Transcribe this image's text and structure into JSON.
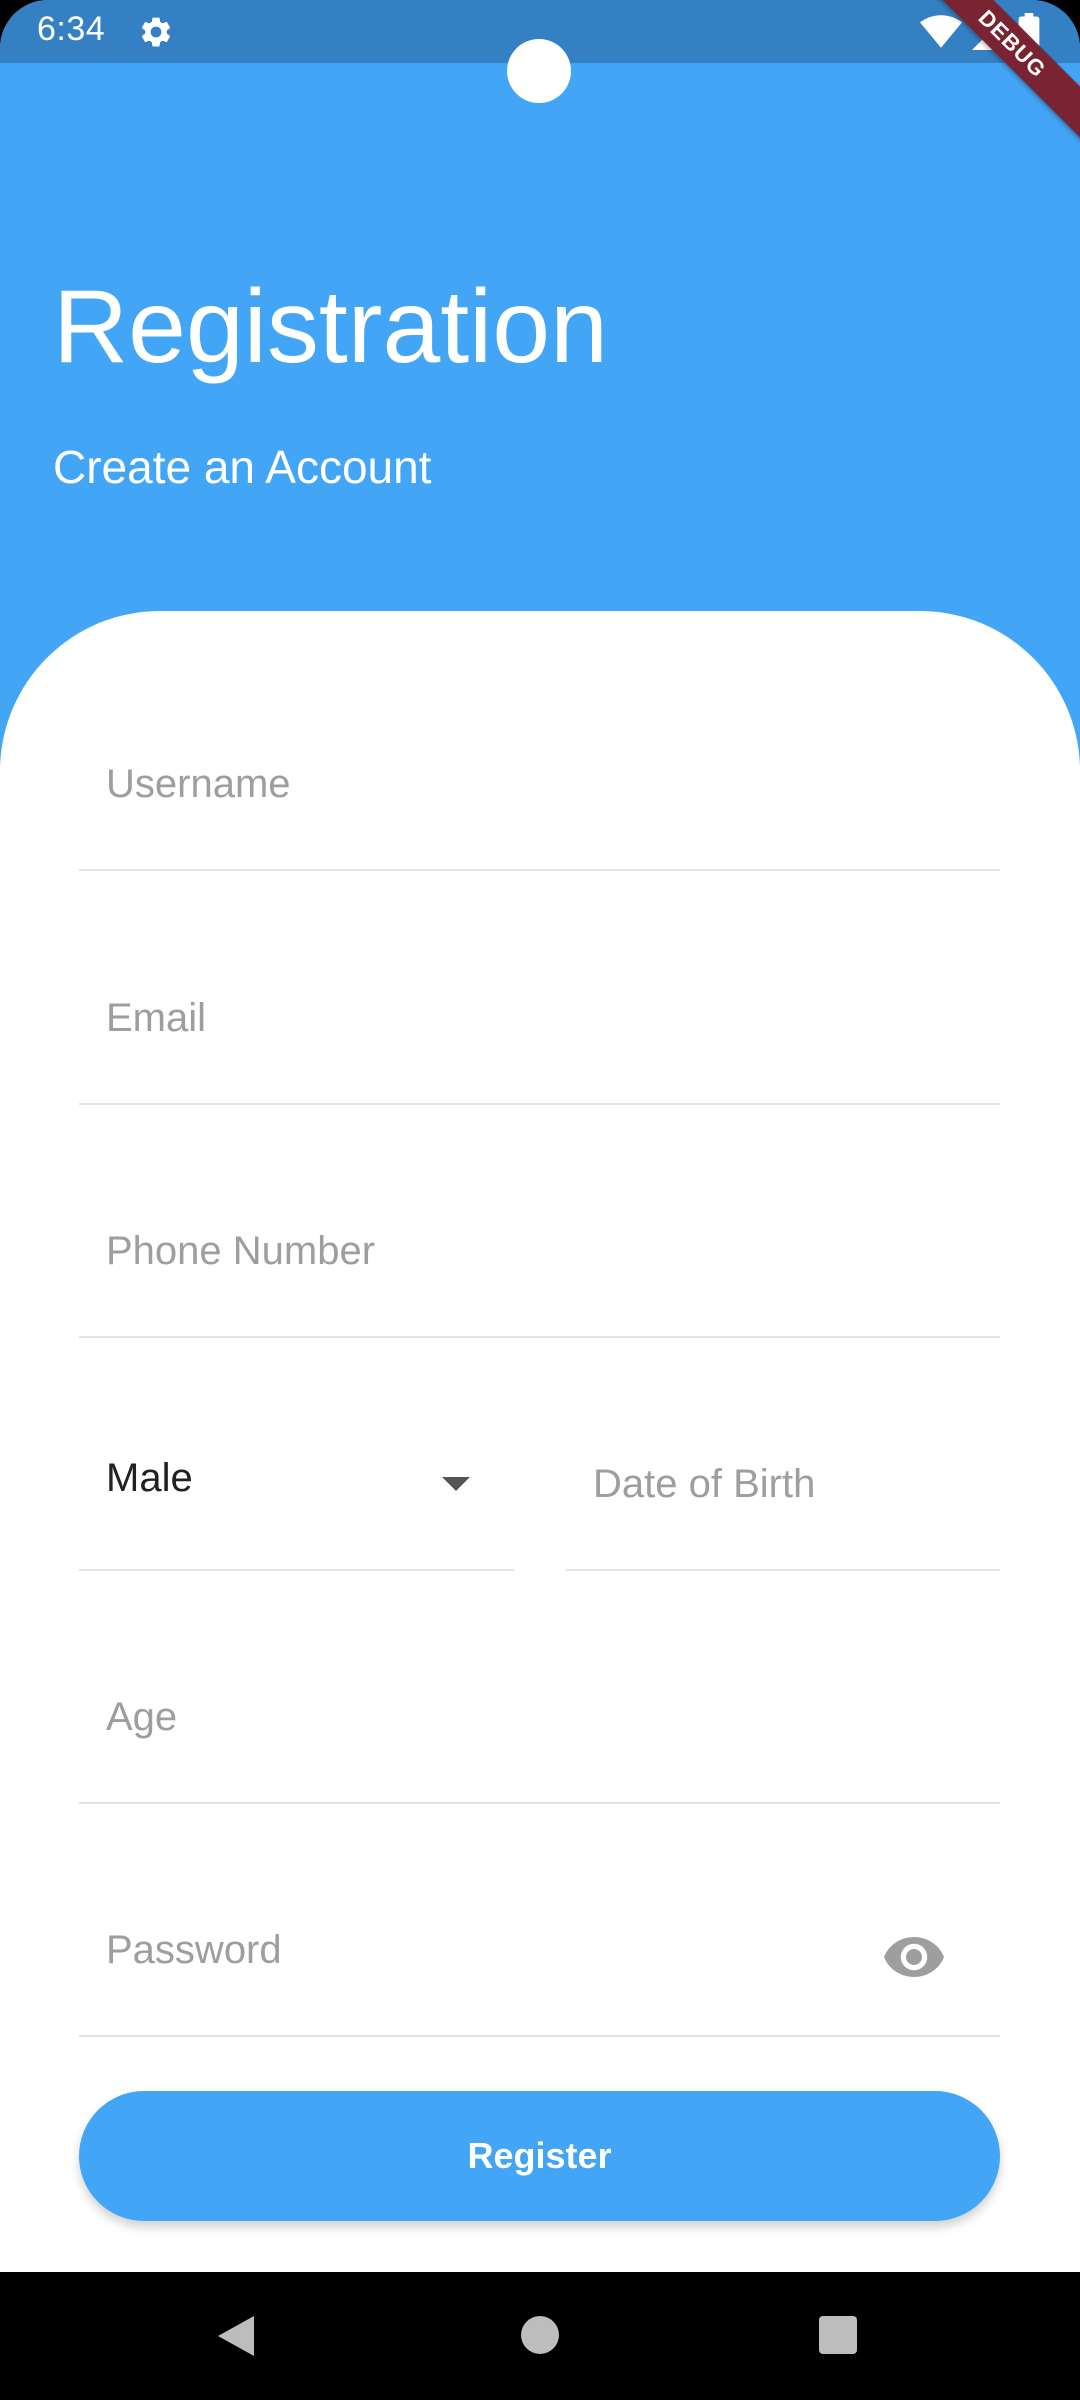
{
  "status_bar": {
    "time": "6:34",
    "icons": [
      "gear-icon",
      "wifi-icon",
      "signal-icon",
      "battery-icon"
    ]
  },
  "debug_banner": "DEBUG",
  "header": {
    "title": "Registration",
    "subtitle": "Create an Account"
  },
  "form": {
    "username_label": "Username",
    "email_label": "Email",
    "phone_label": "Phone Number",
    "gender_value": "Male",
    "dob_label": "Date of Birth",
    "age_label": "Age",
    "password_label": "Password",
    "register_label": "Register"
  },
  "nav_bar": {
    "icons": [
      "back-icon",
      "home-icon",
      "recents-icon"
    ]
  },
  "colors": {
    "primary": "#42a5f5",
    "status_bar": "#3480c2",
    "debug_ribbon": "#7a2332",
    "hint_text": "#9e9e9e",
    "divider": "#e3e3e3"
  }
}
